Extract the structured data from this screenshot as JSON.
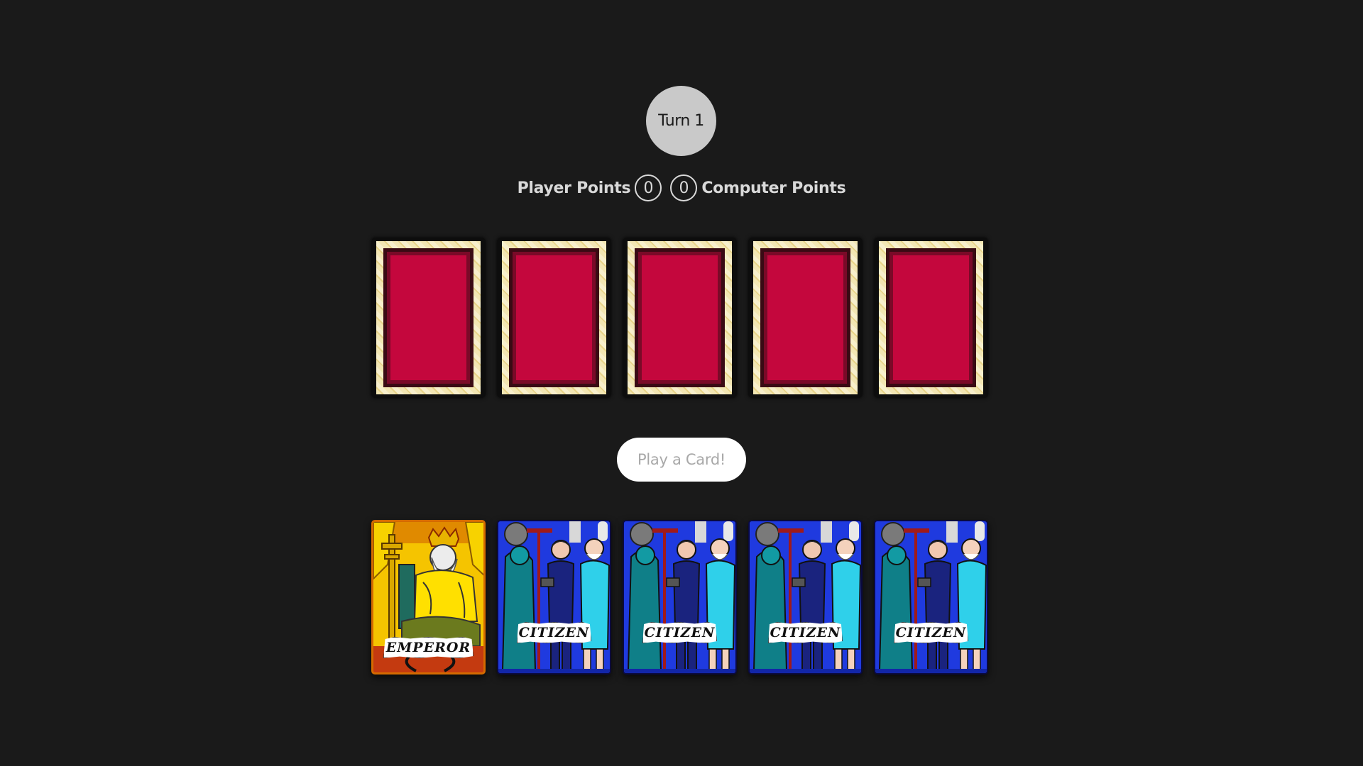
{
  "turn": {
    "label": "Turn 1"
  },
  "score": {
    "player_label": "Player Points",
    "player_value": "0",
    "computer_value": "0",
    "computer_label": "Computer Points"
  },
  "opponent_hand": {
    "count": 5,
    "card_back_icon": "card-back-pattern",
    "colors": {
      "border": "#f2e6b3",
      "core": "#c4073d"
    }
  },
  "play_button": {
    "label": "Play a Card!"
  },
  "player_hand": {
    "cards": [
      {
        "name": "EMPEROR",
        "icon": "emperor-card-art"
      },
      {
        "name": "CITIZEN",
        "icon": "citizen-card-art"
      },
      {
        "name": "CITIZEN",
        "icon": "citizen-card-art"
      },
      {
        "name": "CITIZEN",
        "icon": "citizen-card-art"
      },
      {
        "name": "CITIZEN",
        "icon": "citizen-card-art"
      }
    ]
  },
  "colors": {
    "background": "#1a1a1a",
    "turn_badge": "#c9c9c9",
    "emperor_card": "#f5c400",
    "citizen_card": "#1a2ccc"
  }
}
